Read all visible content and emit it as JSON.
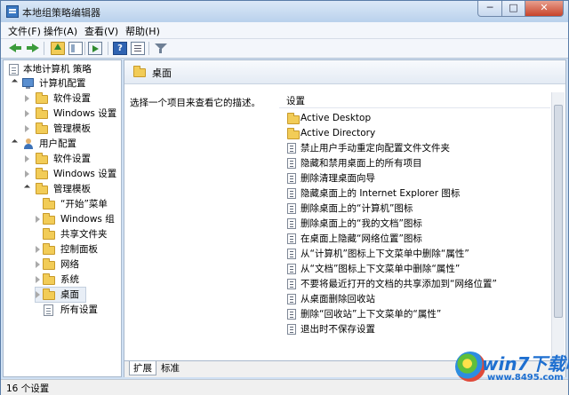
{
  "window": {
    "title": "本地组策略编辑器"
  },
  "window_controls": {
    "minimize": "─",
    "maximize": "□",
    "close": "✕"
  },
  "menu": [
    "文件(F)",
    "操作(A)",
    "查看(V)",
    "帮助(H)"
  ],
  "toolbar_icons": [
    "back-arrow-icon",
    "forward-arrow-icon",
    "up-folder-icon",
    "show-tree-icon",
    "export-list-icon",
    "help-icon",
    "properties-icon",
    "filter-icon"
  ],
  "tree": {
    "root": "本地计算机 策略",
    "computer_config": {
      "label": "计算机配置",
      "children": [
        "软件设置",
        "Windows 设置",
        "管理模板"
      ]
    },
    "user_config": {
      "label": "用户配置",
      "children": [
        "软件设置",
        "Windows 设置"
      ],
      "admin_templates": {
        "label": "管理模板",
        "children": [
          "“开始”菜单",
          "Windows 组",
          "共享文件夹",
          "控制面板",
          "网络",
          "系统",
          "桌面",
          "所有设置"
        ]
      }
    }
  },
  "content": {
    "header_title": "桌面",
    "description": "选择一个项目来查看它的描述。",
    "column_header": "设置",
    "items": [
      {
        "type": "folder",
        "label": "Active Desktop"
      },
      {
        "type": "folder",
        "label": "Active Directory"
      },
      {
        "type": "policy",
        "label": "禁止用户手动重定向配置文件文件夹"
      },
      {
        "type": "policy",
        "label": "隐藏和禁用桌面上的所有项目"
      },
      {
        "type": "policy",
        "label": "删除清理桌面向导"
      },
      {
        "type": "policy",
        "label": "隐藏桌面上的 Internet Explorer 图标"
      },
      {
        "type": "policy",
        "label": "删除桌面上的“计算机”图标"
      },
      {
        "type": "policy",
        "label": "删除桌面上的“我的文档”图标"
      },
      {
        "type": "policy",
        "label": "在桌面上隐藏“网络位置”图标"
      },
      {
        "type": "policy",
        "label": "从“计算机”图标上下文菜单中删除“属性”"
      },
      {
        "type": "policy",
        "label": "从“文档”图标上下文菜单中删除“属性”"
      },
      {
        "type": "policy",
        "label": "不要将最近打开的文档的共享添加到“网络位置”"
      },
      {
        "type": "policy",
        "label": "从桌面删除回收站"
      },
      {
        "type": "policy",
        "label": "删除“回收站”上下文菜单的“属性”"
      },
      {
        "type": "policy",
        "label": "退出时不保存设置"
      }
    ],
    "tabs": [
      "扩展",
      "标准"
    ]
  },
  "status": {
    "text": "16 个设置"
  },
  "watermark": {
    "brand": "win7下载吧",
    "url": "www.8495.com"
  }
}
